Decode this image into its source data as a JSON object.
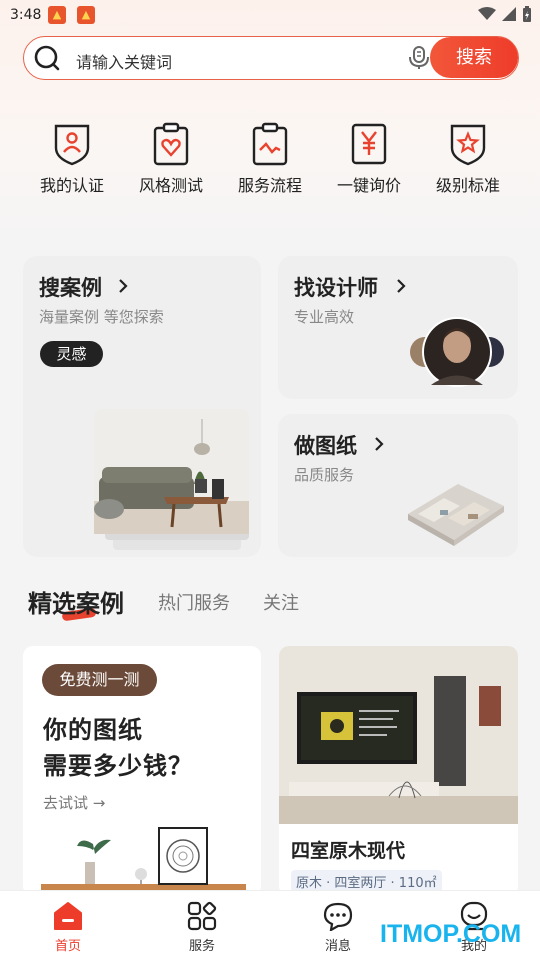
{
  "status_bar": {
    "time": "3:48"
  },
  "search": {
    "placeholder": "请输入关键词",
    "button_label": "搜索"
  },
  "quick_actions": [
    {
      "label": "我的认证",
      "icon": "shield-user-icon"
    },
    {
      "label": "风格测试",
      "icon": "clipboard-heart-icon"
    },
    {
      "label": "服务流程",
      "icon": "clipboard-chart-icon"
    },
    {
      "label": "一键询价",
      "icon": "yen-document-icon"
    },
    {
      "label": "级别标准",
      "icon": "shield-star-icon"
    }
  ],
  "cards": {
    "search_cases": {
      "title": "搜案例",
      "subtitle": "海量案例 等您探索",
      "tag": "灵感"
    },
    "find_designer": {
      "title": "找设计师",
      "subtitle": "专业高效"
    },
    "make_drawing": {
      "title": "做图纸",
      "subtitle": "品质服务"
    }
  },
  "tabs": {
    "active": "精选案例",
    "items": [
      "热门服务",
      "关注"
    ]
  },
  "feed": {
    "promo": {
      "pill": "免费测一测",
      "line1": "你的图纸",
      "line2": "需要多少钱？",
      "link": "去试试"
    },
    "case": {
      "title": "四室原木现代",
      "meta": "原木 · 四室两厅 · 110㎡"
    }
  },
  "bottom_nav": [
    {
      "label": "首页",
      "icon": "home-icon",
      "active": true
    },
    {
      "label": "服务",
      "icon": "grid-icon",
      "active": false
    },
    {
      "label": "消息",
      "icon": "chat-icon",
      "active": false
    },
    {
      "label": "我的",
      "icon": "profile-icon",
      "active": false
    }
  ],
  "watermark": "ITMOP.COM",
  "colors": {
    "accent": "#ee3c2a",
    "promo_brown": "#6b4a39",
    "watermark": "#19b4ee"
  }
}
